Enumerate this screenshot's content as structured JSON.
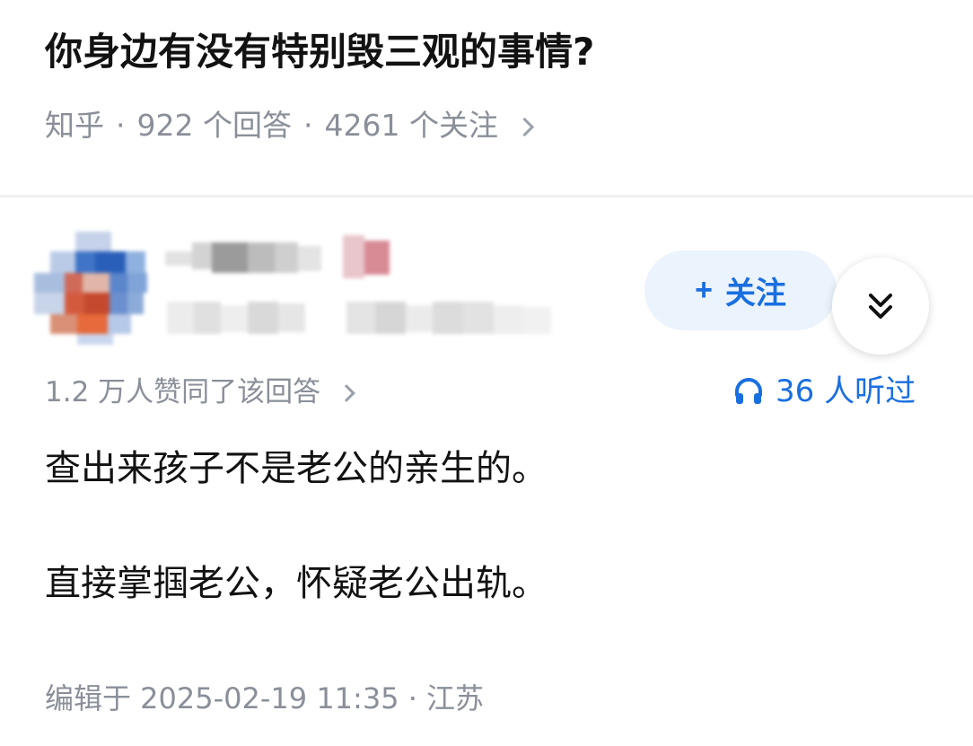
{
  "question": {
    "title": "你身边有没有特别毁三观的事情?",
    "source": "知乎",
    "separator": "·",
    "answers_count": "922 个回答",
    "followers_count": "4261 个关注"
  },
  "answer": {
    "follow_label": "关注",
    "follow_plus": "+",
    "votes_text": "1.2 万人赞同了该回答",
    "listen_text": "36 人听过",
    "paragraphs": [
      "查出来孩子不是老公的亲生的。",
      "直接掌掴老公，怀疑老公出轨。"
    ],
    "edit_info": "编辑于 2025-02-19 11:35 · 江苏"
  },
  "colors": {
    "accent": "#1a6fe0",
    "follow_bg": "#ebf3fd",
    "meta_text": "#8a8f99",
    "body_text": "#121212"
  },
  "icons": {
    "listen": "headphones-icon",
    "expand": "double-chevron-down-icon",
    "more": "chevron-right-icon"
  }
}
